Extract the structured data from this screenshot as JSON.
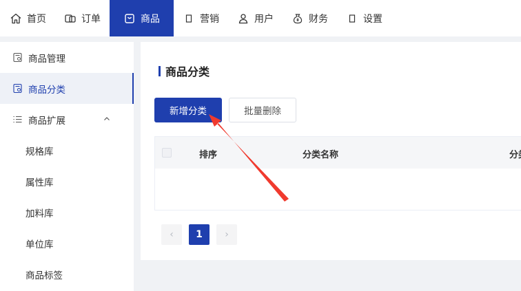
{
  "nav": [
    {
      "label": "首页",
      "icon": "home-icon"
    },
    {
      "label": "订单",
      "icon": "orders-icon"
    },
    {
      "label": "商品",
      "icon": "goods-bag-icon",
      "active": true
    },
    {
      "label": "营销",
      "icon": "marketing-icon"
    },
    {
      "label": "用户",
      "icon": "user-icon"
    },
    {
      "label": "财务",
      "icon": "money-bag-icon"
    },
    {
      "label": "设置",
      "icon": "settings-icon"
    }
  ],
  "sidebar": {
    "items": [
      {
        "label": "商品管理",
        "icon": "goods-manage-icon"
      },
      {
        "label": "商品分类",
        "icon": "goods-category-icon",
        "active": true
      },
      {
        "label": "商品扩展",
        "icon": "list-icon",
        "expanded": true
      }
    ],
    "sub_items": [
      "规格库",
      "属性库",
      "加料库",
      "单位库",
      "商品标签"
    ]
  },
  "main": {
    "title": "商品分类",
    "add_button": "新增分类",
    "batch_delete_button": "批量删除",
    "table": {
      "columns": [
        "排序",
        "分类名称",
        "分类"
      ]
    },
    "pagination": {
      "prev": "‹",
      "current": "1",
      "next": "›"
    }
  },
  "colors": {
    "accent": "#1f3fae",
    "annotation_arrow": "#f03a2e"
  }
}
